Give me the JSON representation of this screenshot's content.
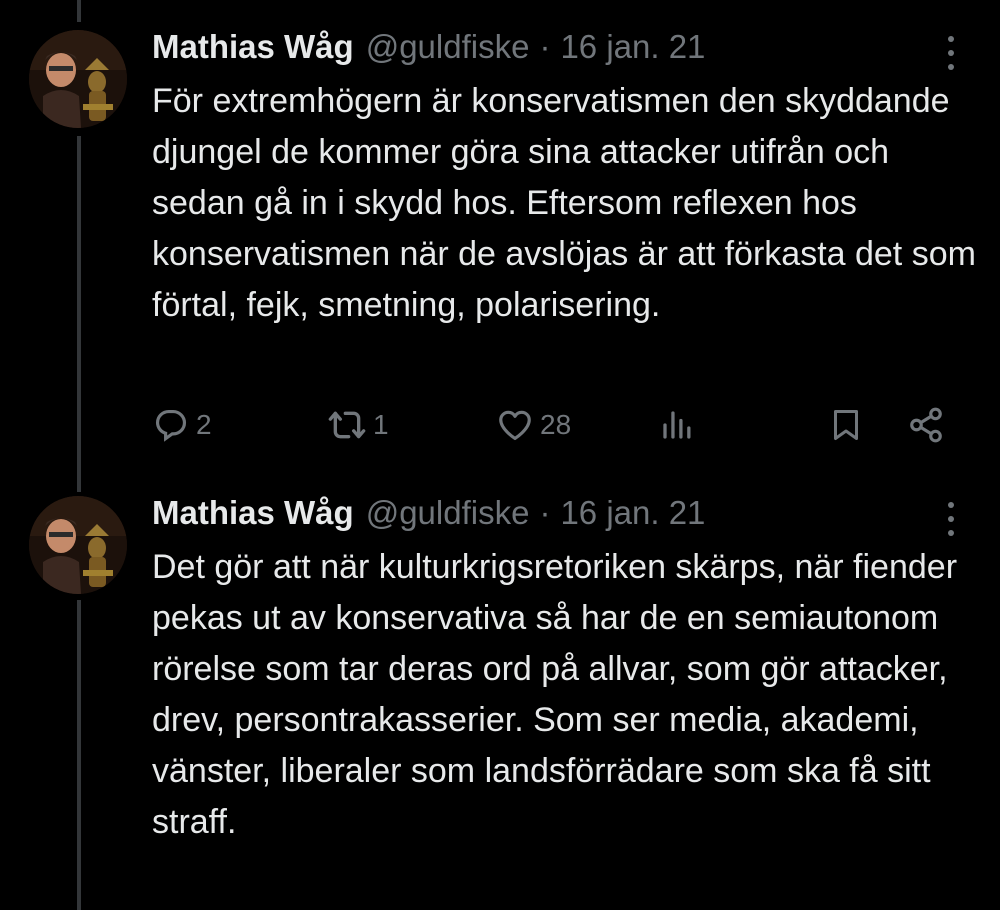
{
  "tweets": [
    {
      "author": {
        "name": "Mathias Wåg",
        "handle": "@guldfiske",
        "avatar": "profile-photo"
      },
      "separator": "·",
      "date": "16 jan. 21",
      "text": "För extremhögern är konservatismen den skyddande djungel de kommer göra sina attacker utifrån och sedan gå in i skydd hos. Eftersom reflexen hos konservatismen när de avslöjas är att förkasta det som förtal, fejk, smetning, polarisering.",
      "actions": {
        "reply_count": "2",
        "retweet_count": "1",
        "like_count": "28"
      }
    },
    {
      "author": {
        "name": "Mathias Wåg",
        "handle": "@guldfiske",
        "avatar": "profile-photo"
      },
      "separator": "·",
      "date": "16 jan. 21",
      "text": "Det gör att när kulturkrigsretoriken skärps, när fiender pekas ut av konservativa så har de en semiautonom rörelse som tar deras ord på allvar, som gör attacker, drev, persontrakasserier. Som ser media, akademi, vänster, liberaler som landsförrädare som ska få sitt straff."
    }
  ],
  "icons": {
    "reply": "reply-icon",
    "retweet": "retweet-icon",
    "like": "heart-icon",
    "views": "views-icon",
    "bookmark": "bookmark-icon",
    "share": "share-icon",
    "more": "more-vertical-icon"
  },
  "colors": {
    "background": "#000000",
    "text": "#e7e9ea",
    "secondary": "#71767b",
    "thread_line": "#333639"
  }
}
